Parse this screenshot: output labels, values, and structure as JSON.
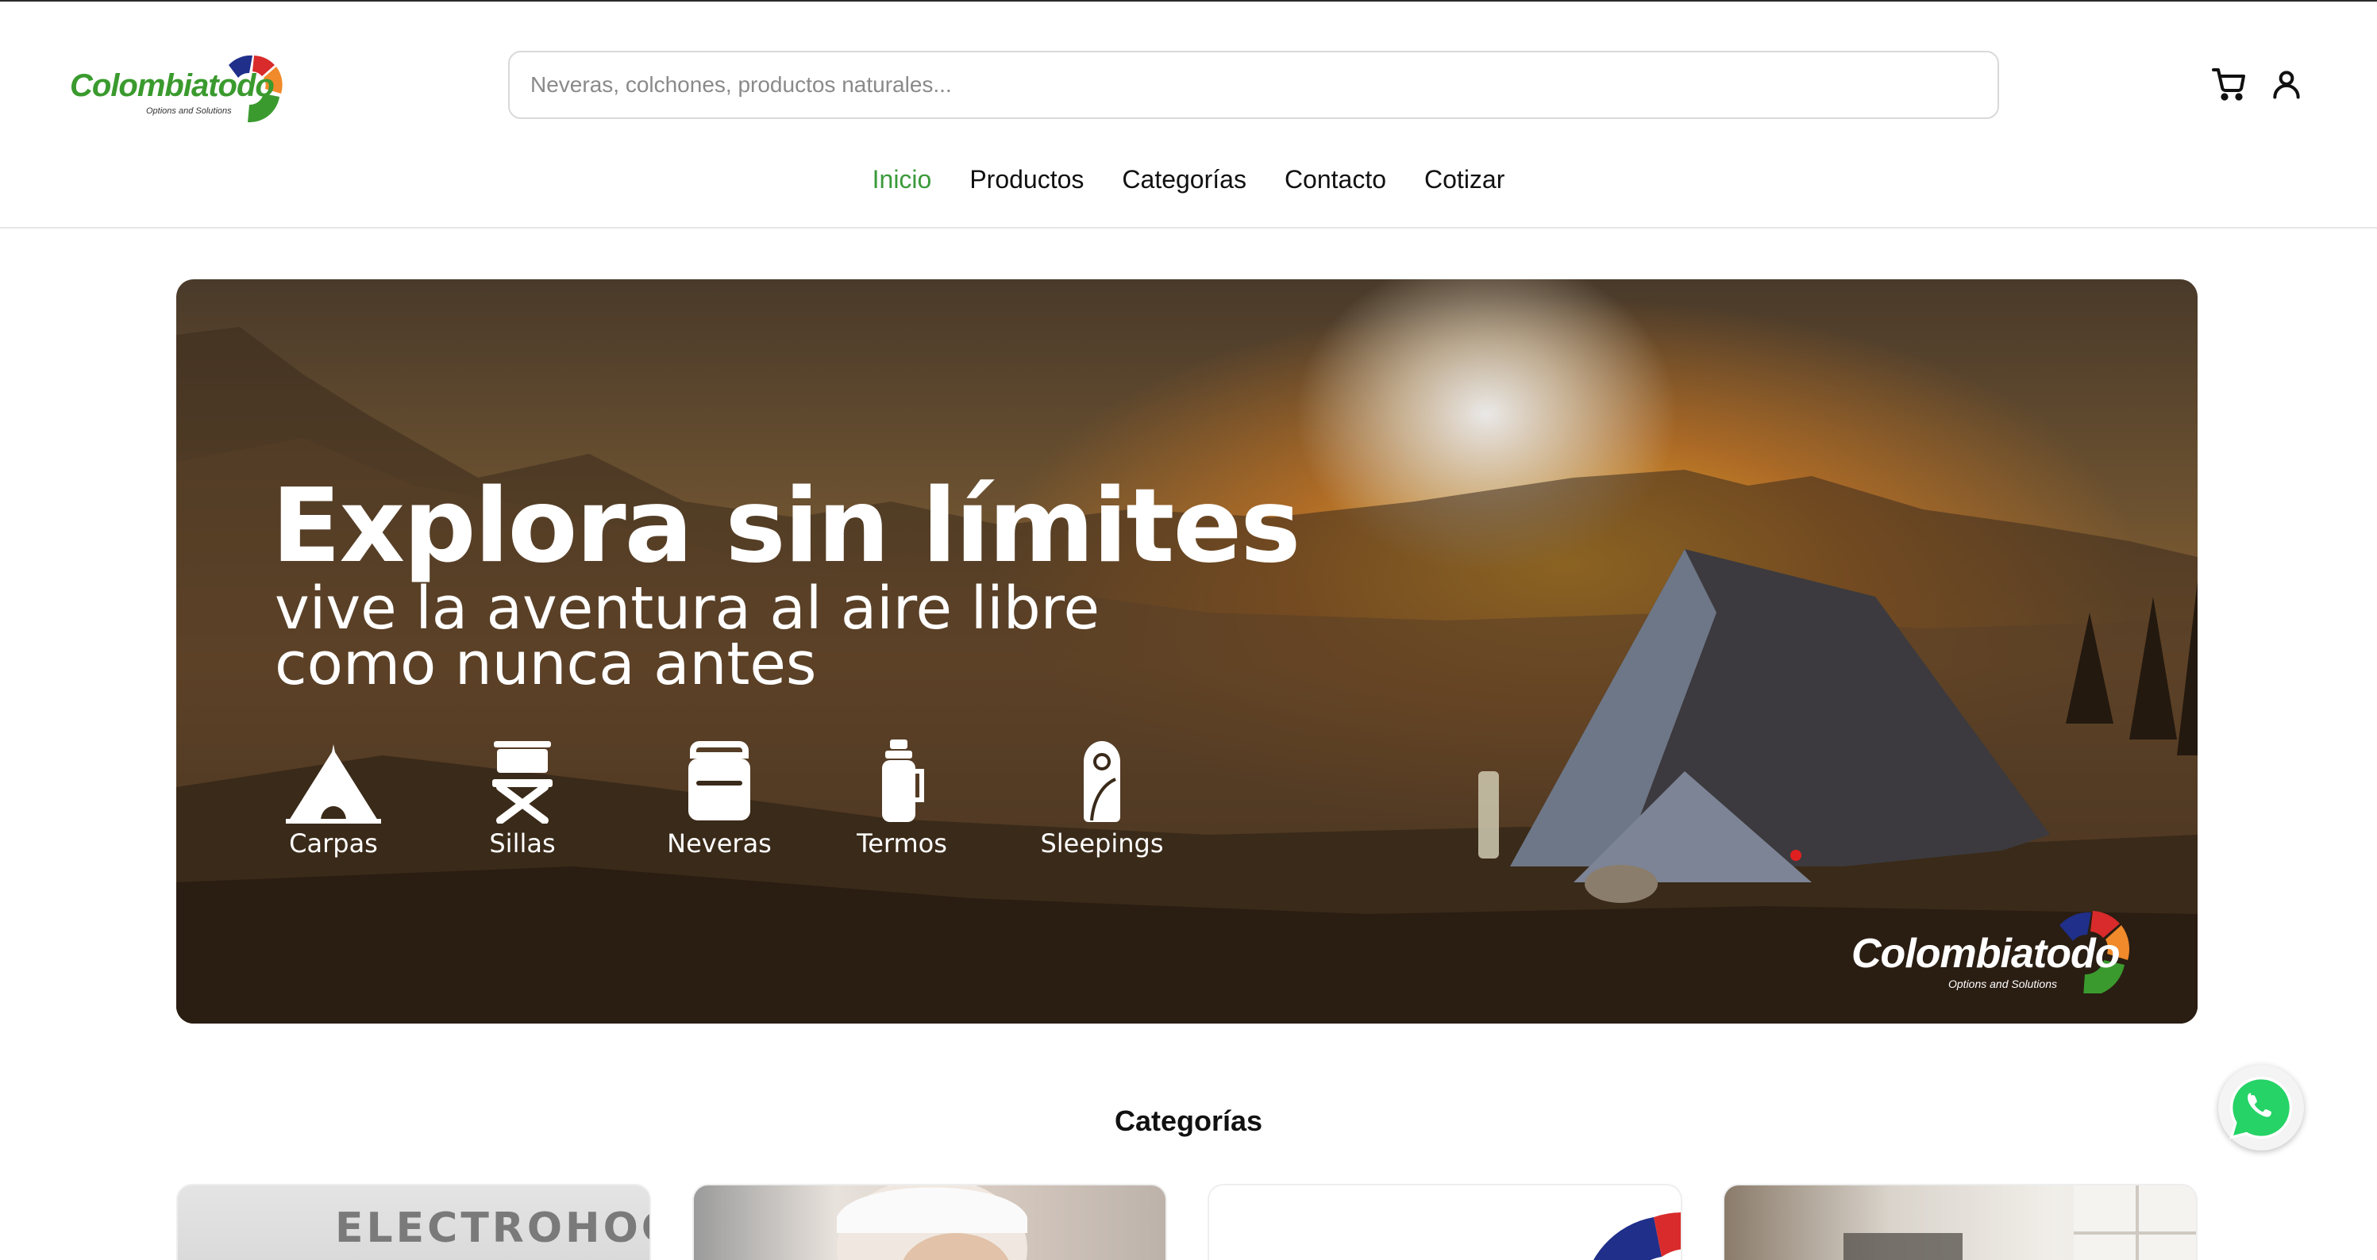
{
  "brand": {
    "logo_text": "Colombiatodo",
    "logo_tagline": "Options and Solutions",
    "colors": {
      "green": "#3a9a2e",
      "blue": "#1f2f8a",
      "red": "#d92b2b",
      "orange": "#f08a2a"
    }
  },
  "search": {
    "placeholder": "Neveras, colchones, productos naturales...",
    "value": ""
  },
  "header_icons": {
    "cart": "cart-icon",
    "user": "user-icon"
  },
  "nav": {
    "items": [
      {
        "label": "Inicio",
        "active": true
      },
      {
        "label": "Productos",
        "active": false
      },
      {
        "label": "Categorías",
        "active": false
      },
      {
        "label": "Contacto",
        "active": false
      },
      {
        "label": "Cotizar",
        "active": false
      }
    ],
    "active_color": "#3a9a3a"
  },
  "hero": {
    "title": "Explora sin límites",
    "subtitle_line1": "vive la aventura al aire libre",
    "subtitle_line2": "como nunca antes",
    "features": [
      {
        "label": "Carpas",
        "icon": "tent-icon"
      },
      {
        "label": "Sillas",
        "icon": "chair-icon"
      },
      {
        "label": "Neveras",
        "icon": "cooler-icon"
      },
      {
        "label": "Termos",
        "icon": "thermos-icon"
      },
      {
        "label": "Sleepings",
        "icon": "sleeping-bag-icon"
      }
    ],
    "logo_text": "Colombiatodo",
    "logo_tagline": "Options and Solutions"
  },
  "categories": {
    "title": "Categorías",
    "cards": [
      {
        "label": "ELECTROHOGA"
      },
      {
        "label": ""
      },
      {
        "label": ""
      },
      {
        "label": ""
      }
    ]
  },
  "floating": {
    "whatsapp": "whatsapp-icon"
  }
}
